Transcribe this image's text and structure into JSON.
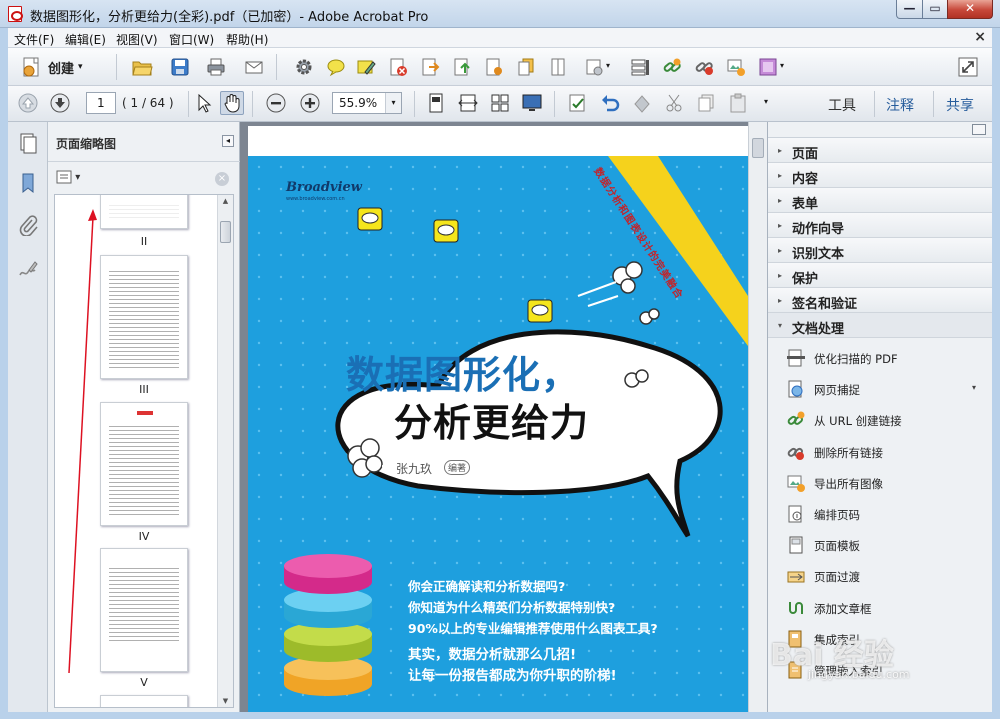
{
  "window": {
    "title": "数据图形化，分析更给力(全彩).pdf（已加密）- Adobe Acrobat Pro",
    "min_glyph": "—",
    "max_glyph": "▭",
    "close_glyph": "✕"
  },
  "menu": {
    "items": [
      "文件(F)",
      "编辑(E)",
      "视图(V)",
      "窗口(W)",
      "帮助(H)"
    ],
    "close_glyph": "×"
  },
  "toolbar": {
    "create_label": "创建",
    "create_caret": "▾"
  },
  "nav": {
    "current_page": "1",
    "page_count": "( 1 / 64 )",
    "zoom": "55.9%",
    "zoom_caret": "▾",
    "more_caret": "▾"
  },
  "right_links": {
    "tools": "工具",
    "comment": "注释",
    "share": "共享"
  },
  "thumbnails": {
    "title": "页面缩略图",
    "collapse_glyph": "◂",
    "options_caret": "▾",
    "clear_glyph": "×",
    "pages": [
      {
        "label": "II"
      },
      {
        "label": "III"
      },
      {
        "label": "IV"
      },
      {
        "label": "V"
      }
    ]
  },
  "cover": {
    "brand": "Broadview",
    "brand_sub": "www.broadview.com.cn",
    "banner": "数据分析和图表设计的完美融合",
    "title_line1": "数据图形化，",
    "title_line2": "分析更给力",
    "author": "张九玖",
    "author_role": "编著",
    "bullets": [
      "你会正确解读和分析数据吗?",
      "你知道为什么精英们分析数据特别快?",
      "90%以上的专业编辑推荐使用什么图表工具?",
      "其实，数据分析就那么几招!",
      "让每一份报告都成为你升职的阶梯!"
    ]
  },
  "panel": {
    "sections": [
      {
        "label": "页面",
        "arrow": "▸"
      },
      {
        "label": "内容",
        "arrow": "▸"
      },
      {
        "label": "表单",
        "arrow": "▸"
      },
      {
        "label": "动作向导",
        "arrow": "▸"
      },
      {
        "label": "识别文本",
        "arrow": "▸"
      },
      {
        "label": "保护",
        "arrow": "▸"
      },
      {
        "label": "签名和验证",
        "arrow": "▸"
      },
      {
        "label": "文档处理",
        "arrow": "▾"
      }
    ],
    "tools": [
      {
        "label": "优化扫描的 PDF"
      },
      {
        "label": "网页捕捉",
        "caret": "▾"
      },
      {
        "label": "从 URL 创建链接"
      },
      {
        "label": "删除所有链接"
      },
      {
        "label": "导出所有图像"
      },
      {
        "label": "编排页码"
      },
      {
        "label": "页面模板"
      },
      {
        "label": "页面过渡"
      },
      {
        "label": "添加文章框"
      },
      {
        "label": "集成索引"
      },
      {
        "label": "管理嵌入索引"
      }
    ]
  },
  "watermark": {
    "text": "Bai 经验",
    "sub": "jingyan.baidu.com"
  },
  "colors": {
    "cover_blue": "#1e9fde",
    "title_blue": "#1a6fb5",
    "accent_red": "#d8232a",
    "banner_yellow": "#f5d21c"
  }
}
